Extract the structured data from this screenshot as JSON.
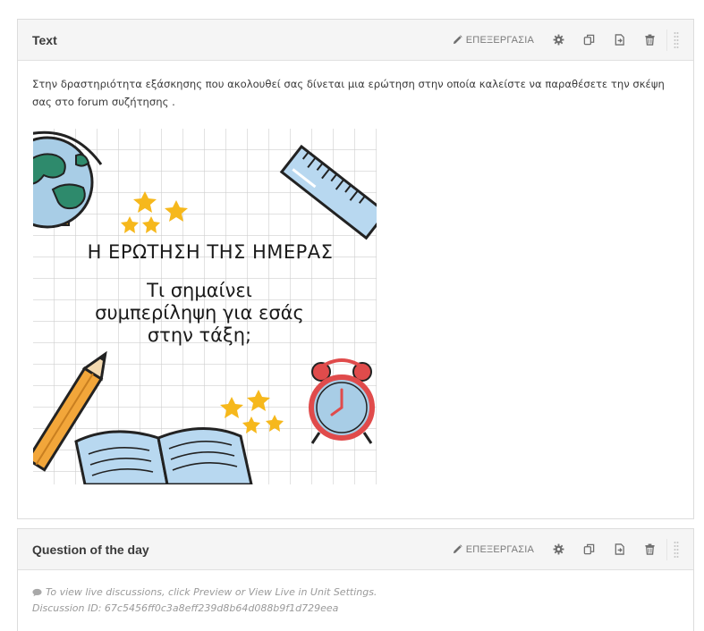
{
  "components": [
    {
      "title": "Text",
      "edit_label": "ΕΠΕΞΕΡΓΑΣΙΑ",
      "intro_text": "Στην δραστηριότητα εξάσκησης που ακολουθεί σας δίνεται μια ερώτηση στην οποία καλείστε να παραθέσετε την σκέψη σας στο forum συζήτησης .",
      "poster": {
        "heading": "Η ΕΡΩΤΗΣΗ ΤΗΣ ΗΜΕΡΑΣ",
        "question_line1": "Τι σημαίνει",
        "question_line2": "συμπερίληψη για εσάς",
        "question_line3": "στην τάξη;"
      }
    },
    {
      "title": "Question of the day",
      "edit_label": "ΕΠΕΞΕΡΓΑΣΙΑ",
      "discussion_note": "To view live discussions, click Preview or View Live in Unit Settings.",
      "discussion_id": "Discussion ID: 67c5456ff0c3a8eff239d8b64d088b9f1d729eea"
    }
  ],
  "colors": {
    "header_bg": "#f5f5f5",
    "border": "#dcdcdc",
    "icon": "#6f6f6f",
    "muted_text": "#9a9a9a",
    "star_yellow": "#f6b81c",
    "globe_blue": "#a8cde6",
    "globe_green": "#2e8a6c"
  },
  "icons": [
    "pencil-icon",
    "gear-icon",
    "duplicate-icon",
    "move-icon",
    "trash-icon",
    "drag-handle-icon",
    "comment-icon"
  ]
}
